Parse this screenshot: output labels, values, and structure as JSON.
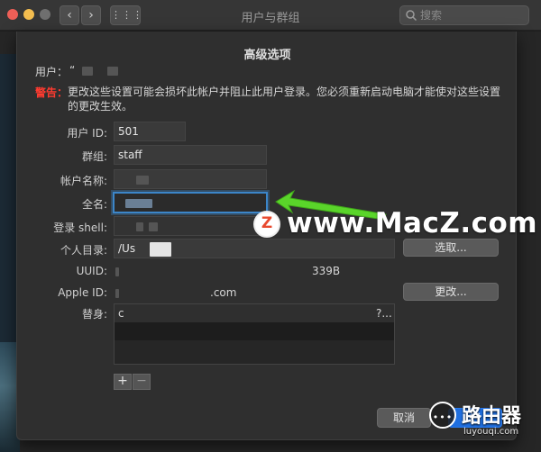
{
  "window": {
    "title": "用户与群组",
    "search_placeholder": "搜索",
    "nav_back": "‹",
    "nav_forward": "›",
    "grid_glyph": "⋮⋮⋮"
  },
  "sheet": {
    "title": "高级选项",
    "user_label": "用户：",
    "user_value": "“",
    "warning_label": "警告：",
    "warning_text": "更改这些设置可能会损坏此帐户并阻止此用户登录。您必须重新启动电脑才能使对这些设置的更改生效。",
    "fields": {
      "user_id": {
        "label": "用户 ID:",
        "value": "501"
      },
      "group": {
        "label": "群组:",
        "value": "staff"
      },
      "account_name": {
        "label": "帐户名称:",
        "value": ""
      },
      "full_name": {
        "label": "全名:",
        "value": ""
      },
      "login_shell": {
        "label": "登录 shell:",
        "value": ""
      },
      "home_dir": {
        "label": "个人目录:",
        "value": "/Us"
      },
      "uuid": {
        "label": "UUID:",
        "value_start": "",
        "value_end": "339B"
      },
      "apple_id": {
        "label": "Apple ID:",
        "value_end": ".com"
      },
      "aliases": {
        "label": "替身:",
        "first_start": "c",
        "first_end": "?..."
      }
    },
    "buttons": {
      "choose": "选取...",
      "change": "更改...",
      "add": "+",
      "remove": "−",
      "cancel": "取消",
      "ok": "好"
    }
  },
  "watermarks": {
    "macz_logo_letter": "Z",
    "macz_text": "www.MacZ.com",
    "lyq_dots": "•••",
    "lyq_cn": "路由器",
    "lyq_url": "luyouqi.com"
  },
  "colors": {
    "accent": "#1f6fe0",
    "focus_ring": "#3c86c9",
    "warning": "#ff3b30",
    "arrow": "#5ad52a"
  }
}
